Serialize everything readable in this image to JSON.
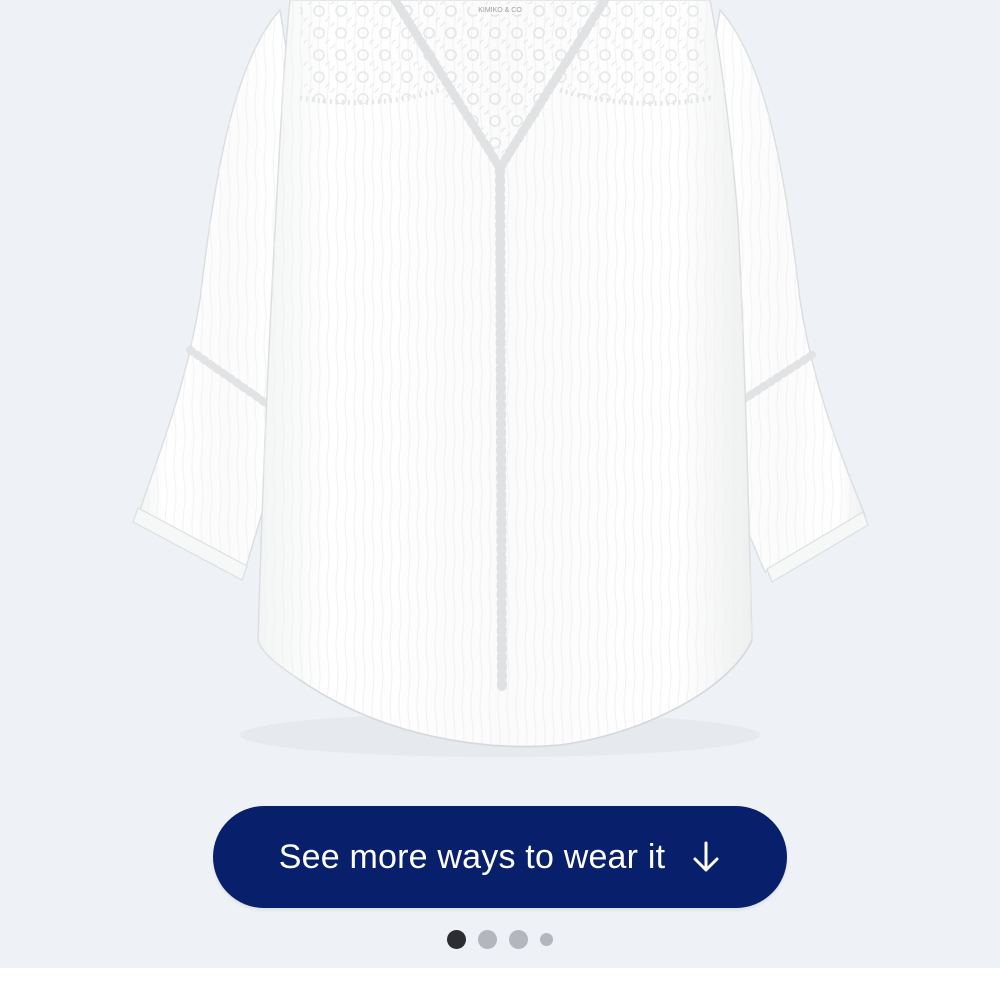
{
  "product": {
    "image_alt": "White crinkle blouse with lace yoke, V-neck and crochet trim",
    "tag_text": "KIMIKO & CO"
  },
  "cta": {
    "label": "See more ways to wear it",
    "icon": "arrow-down-icon",
    "background": "#08206b",
    "text_color": "#ffffff"
  },
  "carousel": {
    "current_page": 1,
    "total_pages": 4,
    "active_color": "#2b2d33",
    "inactive_color": "#b3b6bd"
  },
  "stage": {
    "background": "#eef1f6"
  }
}
